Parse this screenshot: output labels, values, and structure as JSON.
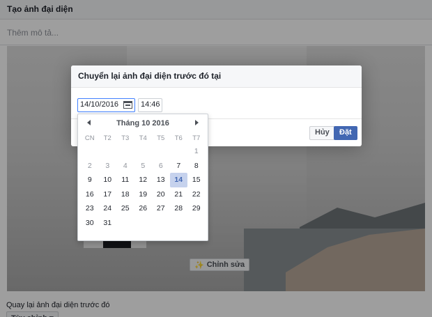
{
  "header": {
    "title": "Tạo ảnh đại diện"
  },
  "description": {
    "placeholder": "Thêm mô tả..."
  },
  "edit_button": {
    "label": "Chỉnh sửa"
  },
  "bottom": {
    "label": "Quay lại ảnh đại diện trước đó",
    "select_label": "Tùy chỉnh ▾"
  },
  "dialog": {
    "title": "Chuyển lại ảnh đại diện trước đó tại",
    "date_value": "14/10/2016",
    "time_value": "14:46",
    "cancel_label": "Hủy",
    "set_label": "Đặt"
  },
  "calendar": {
    "month_title": "Tháng 10 2016",
    "weekdays": [
      "CN",
      "T2",
      "T3",
      "T4",
      "T5",
      "T6",
      "T7"
    ],
    "selected_day": "14",
    "weeks": [
      [
        "",
        "",
        "",
        "",
        "",
        "",
        "1"
      ],
      [
        "2",
        "3",
        "4",
        "5",
        "6",
        "7",
        "8"
      ],
      [
        "9",
        "10",
        "11",
        "12",
        "13",
        "14",
        "15"
      ],
      [
        "16",
        "17",
        "18",
        "19",
        "20",
        "21",
        "22"
      ],
      [
        "23",
        "24",
        "25",
        "26",
        "27",
        "28",
        "29"
      ],
      [
        "30",
        "31",
        "",
        "",
        "",
        "",
        ""
      ]
    ],
    "muted_days": [
      "1",
      "2",
      "3",
      "4",
      "5",
      "6"
    ]
  }
}
